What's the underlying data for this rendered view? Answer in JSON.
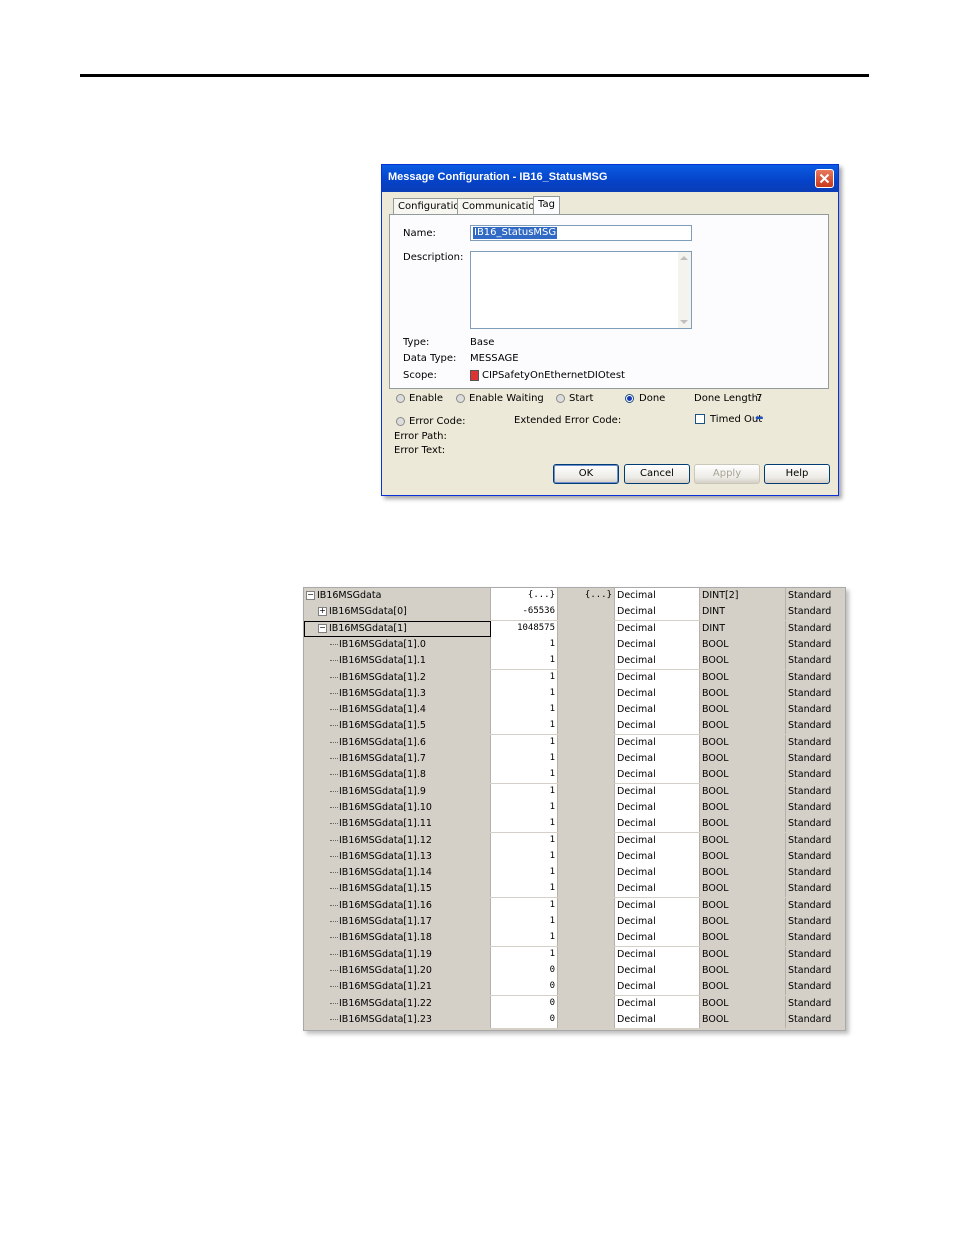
{
  "dialog": {
    "title": "Message Configuration - IB16_StatusMSG",
    "tabs": [
      "Configuration",
      "Communication",
      "Tag"
    ],
    "name_label": "Name:",
    "name_value": "IB16_StatusMSG",
    "description_label": "Description:",
    "type_label": "Type:",
    "type_value": "Base",
    "data_type_label": "Data Type:",
    "data_type_value": "MESSAGE",
    "scope_label": "Scope:",
    "scope_value": "CIPSafetyOnEthernetDIOtest",
    "status": {
      "enable": "Enable",
      "enable_waiting": "Enable Waiting",
      "start": "Start",
      "done": "Done",
      "done_length_label": "Done Length:",
      "done_length_value": "7",
      "error_code": "Error Code:",
      "extended_error_code": "Extended Error Code:",
      "timed_out": "Timed Out",
      "error_path": "Error Path:",
      "error_text": "Error Text:"
    },
    "buttons": {
      "ok": "OK",
      "cancel": "Cancel",
      "apply": "Apply",
      "help": "Help"
    }
  },
  "tag_table": {
    "rows": [
      {
        "name": "IB16MSGdata",
        "value": "{...}",
        "force": "{...}",
        "style": "Decimal",
        "type": "DINT[2]",
        "class": "Standard",
        "level": 0,
        "expander": "−"
      },
      {
        "name": "IB16MSGdata[0]",
        "value": "-65536",
        "force": "",
        "style": "Decimal",
        "type": "DINT",
        "class": "Standard",
        "level": 1,
        "expander": "+"
      },
      {
        "name": "IB16MSGdata[1]",
        "value": "1048575",
        "force": "",
        "style": "Decimal",
        "type": "DINT",
        "class": "Standard",
        "level": 1,
        "expander": "−"
      },
      {
        "name": "IB16MSGdata[1].0",
        "value": "1",
        "force": "",
        "style": "Decimal",
        "type": "BOOL",
        "class": "Standard",
        "level": 2
      },
      {
        "name": "IB16MSGdata[1].1",
        "value": "1",
        "force": "",
        "style": "Decimal",
        "type": "BOOL",
        "class": "Standard",
        "level": 2
      },
      {
        "name": "IB16MSGdata[1].2",
        "value": "1",
        "force": "",
        "style": "Decimal",
        "type": "BOOL",
        "class": "Standard",
        "level": 2
      },
      {
        "name": "IB16MSGdata[1].3",
        "value": "1",
        "force": "",
        "style": "Decimal",
        "type": "BOOL",
        "class": "Standard",
        "level": 2
      },
      {
        "name": "IB16MSGdata[1].4",
        "value": "1",
        "force": "",
        "style": "Decimal",
        "type": "BOOL",
        "class": "Standard",
        "level": 2
      },
      {
        "name": "IB16MSGdata[1].5",
        "value": "1",
        "force": "",
        "style": "Decimal",
        "type": "BOOL",
        "class": "Standard",
        "level": 2
      },
      {
        "name": "IB16MSGdata[1].6",
        "value": "1",
        "force": "",
        "style": "Decimal",
        "type": "BOOL",
        "class": "Standard",
        "level": 2
      },
      {
        "name": "IB16MSGdata[1].7",
        "value": "1",
        "force": "",
        "style": "Decimal",
        "type": "BOOL",
        "class": "Standard",
        "level": 2
      },
      {
        "name": "IB16MSGdata[1].8",
        "value": "1",
        "force": "",
        "style": "Decimal",
        "type": "BOOL",
        "class": "Standard",
        "level": 2
      },
      {
        "name": "IB16MSGdata[1].9",
        "value": "1",
        "force": "",
        "style": "Decimal",
        "type": "BOOL",
        "class": "Standard",
        "level": 2
      },
      {
        "name": "IB16MSGdata[1].10",
        "value": "1",
        "force": "",
        "style": "Decimal",
        "type": "BOOL",
        "class": "Standard",
        "level": 2
      },
      {
        "name": "IB16MSGdata[1].11",
        "value": "1",
        "force": "",
        "style": "Decimal",
        "type": "BOOL",
        "class": "Standard",
        "level": 2
      },
      {
        "name": "IB16MSGdata[1].12",
        "value": "1",
        "force": "",
        "style": "Decimal",
        "type": "BOOL",
        "class": "Standard",
        "level": 2
      },
      {
        "name": "IB16MSGdata[1].13",
        "value": "1",
        "force": "",
        "style": "Decimal",
        "type": "BOOL",
        "class": "Standard",
        "level": 2
      },
      {
        "name": "IB16MSGdata[1].14",
        "value": "1",
        "force": "",
        "style": "Decimal",
        "type": "BOOL",
        "class": "Standard",
        "level": 2
      },
      {
        "name": "IB16MSGdata[1].15",
        "value": "1",
        "force": "",
        "style": "Decimal",
        "type": "BOOL",
        "class": "Standard",
        "level": 2
      },
      {
        "name": "IB16MSGdata[1].16",
        "value": "1",
        "force": "",
        "style": "Decimal",
        "type": "BOOL",
        "class": "Standard",
        "level": 2
      },
      {
        "name": "IB16MSGdata[1].17",
        "value": "1",
        "force": "",
        "style": "Decimal",
        "type": "BOOL",
        "class": "Standard",
        "level": 2
      },
      {
        "name": "IB16MSGdata[1].18",
        "value": "1",
        "force": "",
        "style": "Decimal",
        "type": "BOOL",
        "class": "Standard",
        "level": 2
      },
      {
        "name": "IB16MSGdata[1].19",
        "value": "1",
        "force": "",
        "style": "Decimal",
        "type": "BOOL",
        "class": "Standard",
        "level": 2
      },
      {
        "name": "IB16MSGdata[1].20",
        "value": "0",
        "force": "",
        "style": "Decimal",
        "type": "BOOL",
        "class": "Standard",
        "level": 2
      },
      {
        "name": "IB16MSGdata[1].21",
        "value": "0",
        "force": "",
        "style": "Decimal",
        "type": "BOOL",
        "class": "Standard",
        "level": 2
      },
      {
        "name": "IB16MSGdata[1].22",
        "value": "0",
        "force": "",
        "style": "Decimal",
        "type": "BOOL",
        "class": "Standard",
        "level": 2
      },
      {
        "name": "IB16MSGdata[1].23",
        "value": "0",
        "force": "",
        "style": "Decimal",
        "type": "BOOL",
        "class": "Standard",
        "level": 2
      }
    ]
  },
  "icons": {
    "close": "close-icon",
    "scope": "controller-icon",
    "timed_out": "arrow-icon"
  },
  "colors": {
    "titlebar": "#0a5ce3",
    "dialog_bg": "#ece9d8",
    "selection": "#316ac5"
  }
}
